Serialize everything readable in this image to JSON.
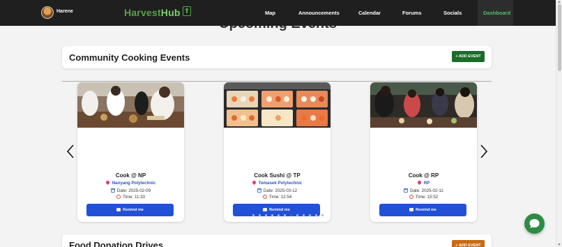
{
  "nav": {
    "username": "Harene",
    "brand_part1": "Harvest",
    "brand_part2": "Hub",
    "links": [
      "Map",
      "Announcements",
      "Calendar",
      "Forums",
      "Socials",
      "Dashboard"
    ],
    "active": "Dashboard"
  },
  "page": {
    "heading": "Upcoming Events"
  },
  "cooking": {
    "title": "Community Cooking Events",
    "add_label": "+ ADD EVENT",
    "cards": [
      {
        "title": "Cook @ NP",
        "location": "Nanyang Polytechnic",
        "date": "Date: 2025-02-09",
        "time": "Time: 11:33",
        "button": "Remind me"
      },
      {
        "title": "Cook Sushi @ TP",
        "location": "Temasek Polytechnic",
        "date": "Date: 2025-03-12",
        "time": "Time: 12:54",
        "button": "Remind me"
      },
      {
        "title": "Cook @ RP",
        "location": "RP",
        "date": "Date: 2025-02-11",
        "time": "Time: 15:52",
        "button": "Remind me"
      }
    ],
    "dots": 12,
    "active_dot": 6
  },
  "donation": {
    "title": "Food Donation Drives",
    "add_label": "+ ADD EVENT"
  },
  "colors": {
    "navbar": "#1f1f1f",
    "brand_green": "#5aa04a",
    "add_button": "#1d6b2a",
    "remind_button": "#2251d8",
    "location_text": "#2b53c9",
    "chat_button": "#2e8b43",
    "donation_button": "#c96a12"
  }
}
